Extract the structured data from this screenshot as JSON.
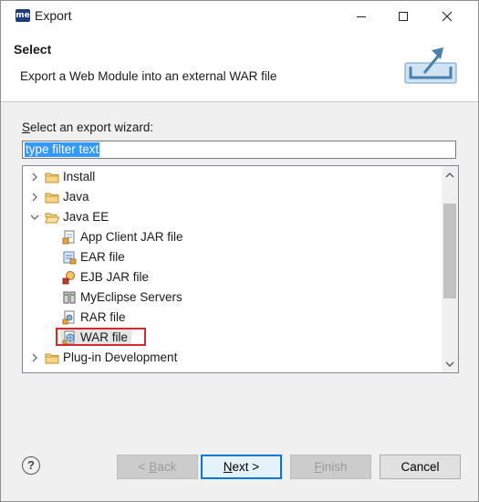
{
  "window": {
    "title": "Export",
    "app_icon_text": "me"
  },
  "header": {
    "title": "Select",
    "description": "Export a Web Module into an external WAR file",
    "icon": "export-icon"
  },
  "wizard": {
    "label": "Select an export wizard:",
    "filter_value": "type filter text"
  },
  "tree": {
    "items": [
      {
        "label": "Install",
        "expanded": false,
        "icon": "folder-icon"
      },
      {
        "label": "Java",
        "expanded": false,
        "icon": "folder-icon"
      },
      {
        "label": "Java EE",
        "expanded": true,
        "icon": "folder-open-icon"
      },
      {
        "label": "App Client JAR file",
        "icon": "app-client-jar-icon"
      },
      {
        "label": "EAR file",
        "icon": "ear-file-icon"
      },
      {
        "label": "EJB JAR file",
        "icon": "ejb-jar-icon"
      },
      {
        "label": "MyEclipse Servers",
        "icon": "servers-icon"
      },
      {
        "label": "RAR file",
        "icon": "rar-file-icon"
      },
      {
        "label": "WAR file",
        "icon": "war-file-icon",
        "selected": true
      },
      {
        "label": "Plug-in Development",
        "expanded": false,
        "icon": "folder-icon"
      }
    ]
  },
  "buttons": {
    "back_mn": "< ",
    "back_u": "B",
    "back_rest": "ack",
    "next_u": "N",
    "next_rest": "ext >",
    "finish_u": "F",
    "finish_rest": "inish",
    "cancel": "Cancel"
  },
  "colors": {
    "accent": "#0078d7",
    "highlight_box": "#d42a2a",
    "selection": "#3399ff",
    "folder": "#e8b84a"
  }
}
